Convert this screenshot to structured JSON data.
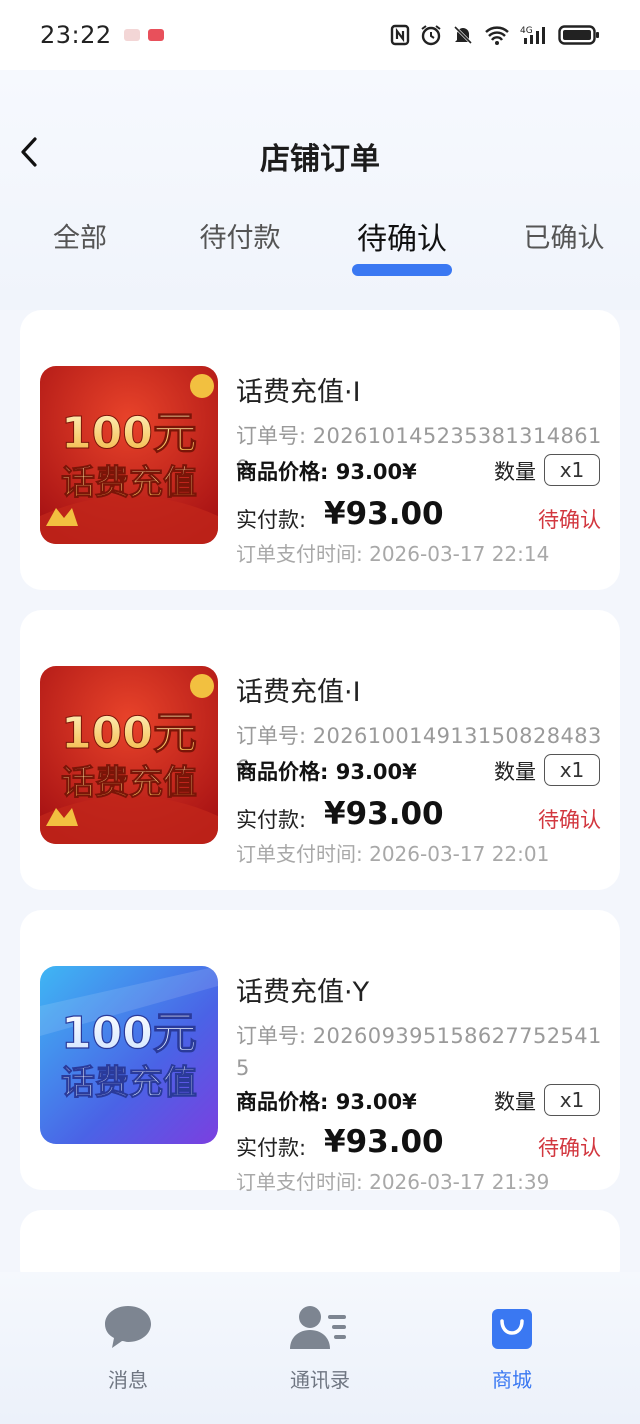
{
  "status_bar": {
    "time": "23:22",
    "icons": [
      "nfc-icon",
      "alarm-icon",
      "mute-icon",
      "wifi-icon",
      "signal-4g-icon",
      "battery-icon"
    ]
  },
  "header": {
    "title": "店铺订单",
    "tabs": [
      {
        "label": "全部",
        "active": false
      },
      {
        "label": "待付款",
        "active": false
      },
      {
        "label": "待确认",
        "active": true
      },
      {
        "label": "已确认",
        "active": false
      }
    ]
  },
  "labels": {
    "order_no": "订单号:",
    "price": "商品价格:",
    "qty": "数量",
    "paid": "实付款:",
    "pay_time": "订单支付时间:"
  },
  "thumb_text": {
    "amount": "100元",
    "caption": "话费充值"
  },
  "orders": [
    {
      "name": "话费充值·I",
      "order_no": "20261014523538131486​10",
      "price": "93.00¥",
      "qty": "x1",
      "paid": "¥93.00",
      "status": "待确认",
      "pay_time": "2026-03-17 22:14",
      "theme": "red"
    },
    {
      "name": "话费充值·I",
      "order_no": "20261001491315082848​36",
      "price": "93.00¥",
      "qty": "x1",
      "paid": "¥93.00",
      "status": "待确认",
      "pay_time": "2026-03-17 22:01",
      "theme": "red"
    },
    {
      "name": "话费充值·Y",
      "order_no": "20260939515862775254​15",
      "price": "93.00¥",
      "qty": "x1",
      "paid": "¥93.00",
      "status": "待确认",
      "pay_time": "2026-03-17 21:39",
      "theme": "blue"
    }
  ],
  "bottom_nav": [
    {
      "label": "消息",
      "icon": "chat-bubble-icon",
      "active": false
    },
    {
      "label": "通讯录",
      "icon": "contacts-icon",
      "active": false
    },
    {
      "label": "商城",
      "icon": "shopping-bag-icon",
      "active": true
    }
  ],
  "colors": {
    "accent": "#3a78f2",
    "status_pending": "#d2373f"
  }
}
